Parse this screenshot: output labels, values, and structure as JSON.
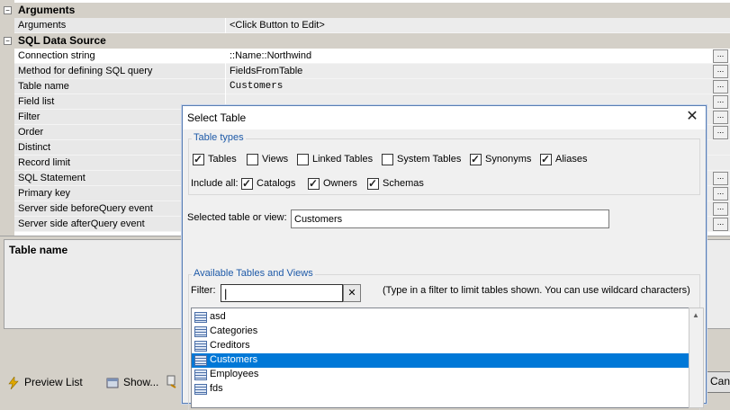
{
  "grid": {
    "sections": [
      {
        "title": "Arguments",
        "collapse": "⊟"
      },
      {
        "title": "SQL Data Source",
        "collapse": "⊟"
      }
    ],
    "rows": [
      {
        "label": "Arguments",
        "value": "<Click Button to Edit>"
      },
      {
        "label": "Connection string",
        "value": "::Name::Northwind"
      },
      {
        "label": "Method for defining SQL query",
        "value": "FieldsFromTable"
      },
      {
        "label": "Table name",
        "value": "Customers"
      },
      {
        "label": "Field list",
        "value": ""
      },
      {
        "label": "Filter",
        "value": ""
      },
      {
        "label": "Order",
        "value": ""
      },
      {
        "label": "Distinct",
        "value": ""
      },
      {
        "label": "Record limit",
        "value": ""
      },
      {
        "label": "SQL Statement",
        "value": ""
      },
      {
        "label": "Primary key",
        "value": ""
      },
      {
        "label": "Server side beforeQuery event",
        "value": ""
      },
      {
        "label": "Server side afterQuery event",
        "value": ""
      }
    ],
    "ellipsis": "..."
  },
  "description": {
    "title": "Table name"
  },
  "bottom": {
    "preview_list": "Preview List",
    "show": "Show...",
    "cancel": "Cancel"
  },
  "dialog": {
    "title": "Select Table",
    "close": "✕",
    "table_types": {
      "legend": "Table types",
      "options": [
        {
          "label": "Tables",
          "checked": true
        },
        {
          "label": "Views",
          "checked": false
        },
        {
          "label": "Linked Tables",
          "checked": false
        },
        {
          "label": "System Tables",
          "checked": false
        },
        {
          "label": "Synonyms",
          "checked": true
        },
        {
          "label": "Aliases",
          "checked": true
        }
      ],
      "include_all_label": "Include all:",
      "include_all": [
        {
          "label": "Catalogs",
          "checked": true
        },
        {
          "label": "Owners",
          "checked": true
        },
        {
          "label": "Schemas",
          "checked": true
        }
      ]
    },
    "selected_label": "Selected table or view:",
    "selected_value": "Customers",
    "available": {
      "legend": "Available Tables and Views",
      "filter_label": "Filter:",
      "filter_value": "",
      "clear": "✕",
      "hint": "(Type in a filter to limit tables shown. You can use wildcard characters)",
      "items": [
        "asd",
        "Categories",
        "Creditors",
        "Customers",
        "Employees",
        "fds"
      ],
      "selected_index": 3
    }
  }
}
